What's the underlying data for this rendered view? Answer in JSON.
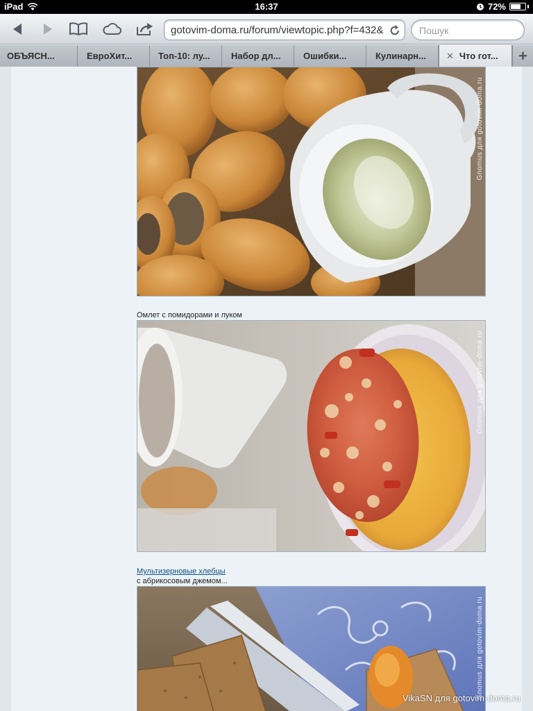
{
  "status": {
    "device": "iPad",
    "time": "16:37",
    "battery": "72%",
    "battery_level": 0.72
  },
  "toolbar": {
    "url": "gotovim-doma.ru/forum/viewtopic.php?f=432&",
    "search_placeholder": "Пошук"
  },
  "tabs": [
    {
      "label": "ОБЪЯСН..."
    },
    {
      "label": "ЕвроХит..."
    },
    {
      "label": "Топ-10: лу..."
    },
    {
      "label": "Набор дл..."
    },
    {
      "label": "Ошибки..."
    },
    {
      "label": "Кулинарн..."
    },
    {
      "label": "Что гот..."
    }
  ],
  "posts": [
    {
      "caption": "",
      "watermark": "Gnomus для gotovim-doma.ru"
    },
    {
      "caption": "Омлет с помидорами и луком",
      "watermark": "Gnomus для gotovim-doma.ru"
    },
    {
      "link": "Мультизерновые хлебцы",
      "caption": "с абрикосовым джемом...",
      "watermark": "Gnomus для gotovim-doma.ru"
    }
  ],
  "footer_watermark": "VikaSN для gotovim-doma.ru",
  "colors": {
    "link": "#105289",
    "page_bg": "#ecf2f6"
  }
}
